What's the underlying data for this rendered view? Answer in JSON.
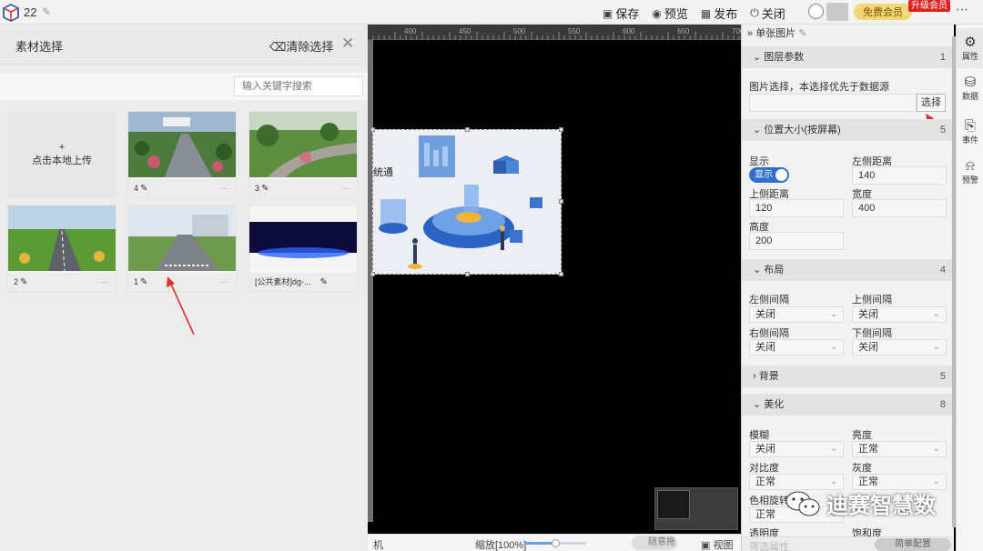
{
  "topbar": {
    "project_name": "22",
    "actions": [
      {
        "id": "save",
        "label": "保存",
        "icon": "save-icon"
      },
      {
        "id": "preview",
        "label": "预览",
        "icon": "eye-icon"
      },
      {
        "id": "publish",
        "label": "发布",
        "icon": "publish-icon"
      },
      {
        "id": "close",
        "label": "关闭",
        "icon": "power-icon"
      }
    ],
    "vip_label": "免费会员",
    "upgrade_label": "升级会员"
  },
  "material_panel": {
    "title": "素材选择",
    "clear_label": "清除选择",
    "search_placeholder": "输入关键字搜索",
    "upload_plus": "+",
    "upload_label": "点击本地上传",
    "tiles": [
      {
        "name": "4",
        "dots": "···"
      },
      {
        "name": "3",
        "dots": "···"
      },
      {
        "name": "2",
        "dots": "···"
      },
      {
        "name": "1",
        "dots": "···"
      },
      {
        "name": "[公共素材]dg-...",
        "dots": ""
      }
    ]
  },
  "canvas": {
    "ruler_ticks": [
      "400",
      "450",
      "500",
      "550",
      "600",
      "650",
      "700"
    ],
    "image_text": "统通",
    "bottom_left": "机",
    "zoom_label": "缩放[100%]",
    "zoom_fraction": 0.5,
    "drag_label": "随意拖拉",
    "view_label": "视图"
  },
  "properties": {
    "header": "单张图片",
    "sections": {
      "layer": {
        "title": "图层参数",
        "count": "1"
      },
      "position": {
        "title": "位置大小(按屏幕)",
        "count": "5"
      },
      "layout": {
        "title": "布局",
        "count": "4"
      },
      "background": {
        "title": "背景",
        "count": "5"
      },
      "beautify": {
        "title": "美化",
        "count": "8"
      }
    },
    "image_select_label": "图片选择，本选择优先于数据源",
    "choose_button": "选择",
    "display_label": "显示",
    "display_toggle": "显示",
    "left_distance_label": "左侧距离",
    "left_distance": "140",
    "top_distance_label": "上侧距离",
    "top_distance": "120",
    "width_label": "宽度",
    "width": "400",
    "height_label": "高度",
    "height": "200",
    "left_gap_label": "左侧间隔",
    "left_gap": "关闭",
    "top_gap_label": "上侧间隔",
    "top_gap": "关闭",
    "right_gap_label": "右侧间隔",
    "right_gap": "关闭",
    "bottom_gap_label": "下侧间隔",
    "bottom_gap": "关闭",
    "blur_label": "模糊",
    "blur": "关闭",
    "brightness_label": "亮度",
    "brightness": "正常",
    "contrast_label": "对比度",
    "contrast": "正常",
    "gray_label": "灰度",
    "gray": "正常",
    "hue_label": "色相旋转",
    "hue": "正常",
    "transparency_label": "透明度",
    "saturation_label": "饱和度",
    "filter_label": "筛选属性",
    "simple_config": "简单配置"
  },
  "icon_bar": [
    {
      "label": "属性",
      "icon": "properties-icon"
    },
    {
      "label": "数据",
      "icon": "database-icon"
    },
    {
      "label": "事件",
      "icon": "event-icon"
    },
    {
      "label": "预警",
      "icon": "alarm-icon"
    }
  ],
  "watermark": "迪赛智慧数",
  "colors": {
    "accent": "#2f6fd0",
    "upgrade_red": "#e02020",
    "vip_gold": "#f6d777",
    "annotation_red": "#e03030"
  }
}
